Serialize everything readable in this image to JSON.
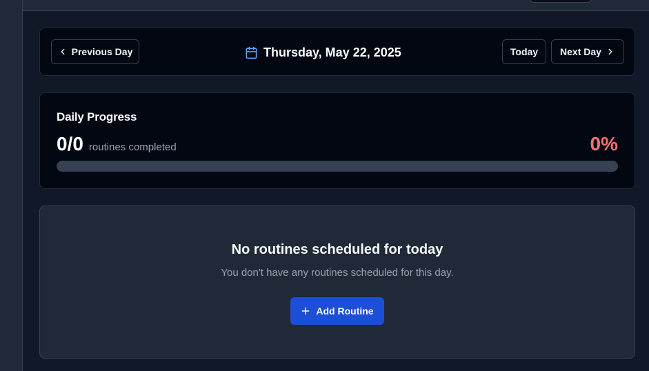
{
  "navigation": {
    "previous_label": "Previous Day",
    "today_label": "Today",
    "next_label": "Next Day",
    "current_date": "Thursday, May 22, 2025"
  },
  "progress": {
    "title": "Daily Progress",
    "count": "0/0",
    "count_label": "routines completed",
    "percent_text": "0%",
    "completed_fraction": 0
  },
  "empty_state": {
    "title": "No routines scheduled for today",
    "subtitle": "You don't have any routines scheduled for this day.",
    "add_button_label": "Add Routine"
  },
  "icons": {
    "previous": "chevron-left-icon",
    "next": "chevron-right-icon",
    "date": "calendar-icon",
    "add": "plus-icon"
  },
  "colors": {
    "background": "#111827",
    "card": "#030712",
    "accent": "#1d4ed8",
    "date_icon": "#60a5fa",
    "percent": "#f87171",
    "progress_track": "#374151"
  }
}
